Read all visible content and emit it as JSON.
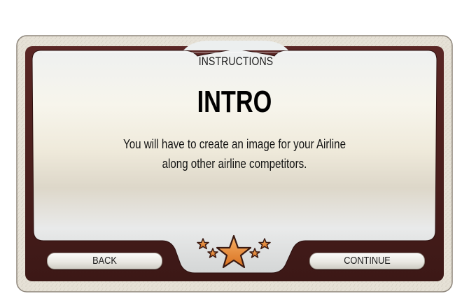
{
  "dialog": {
    "tab_title": "INSTRUCTIONS",
    "heading": "INTRO",
    "body_line1": "You will have to create an image for your Airline",
    "body_line2": "along other airline competitors."
  },
  "buttons": {
    "back_label": "BACK",
    "continue_label": "CONTINUE"
  },
  "icons": {
    "stars": "stars-rating-icon"
  },
  "colors": {
    "frame_brown": "#4a1f1c",
    "frame_border": "#e4ded2",
    "star_orange": "#e88a3a",
    "text": "#111111"
  }
}
